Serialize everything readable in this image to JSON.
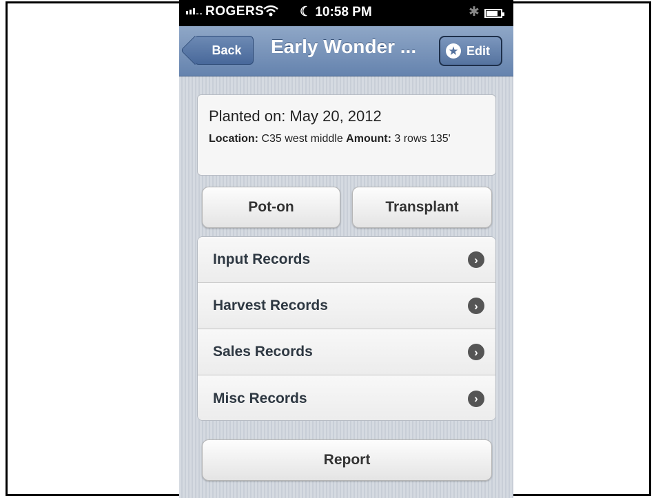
{
  "status_bar": {
    "carrier": "ROGERS",
    "time": "10:58 PM",
    "battery_level": 0.8
  },
  "nav": {
    "back_label": "Back",
    "title": "Early Wonder ...",
    "edit_label": "Edit"
  },
  "info": {
    "planted": "Planted on: May 20, 2012",
    "location_label": "Location:",
    "location_value": " C35 west middle ",
    "amount_label": "Amount:",
    "amount_value": " 3 rows 135'"
  },
  "actions": {
    "pot_on": "Pot-on",
    "transplant": "Transplant",
    "report": "Report"
  },
  "records": [
    {
      "label": "Input Records"
    },
    {
      "label": "Harvest Records"
    },
    {
      "label": "Sales Records"
    },
    {
      "label": "Misc Records"
    }
  ]
}
